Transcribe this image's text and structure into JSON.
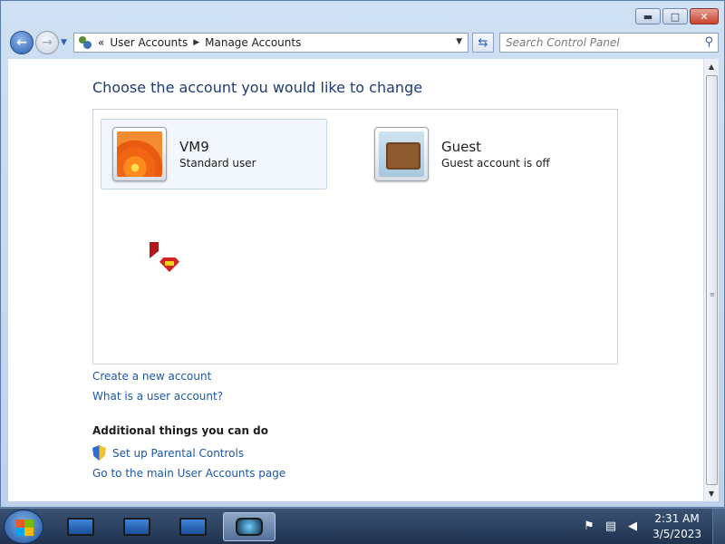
{
  "window": {
    "controls": {
      "minimize": "▬",
      "maximize": "□",
      "close": "✕"
    }
  },
  "nav": {
    "history_chevron": "«",
    "breadcrumbs": [
      "User Accounts",
      "Manage Accounts"
    ],
    "search_placeholder": "Search Control Panel"
  },
  "main": {
    "title": "Choose the account you would like to change",
    "accounts": [
      {
        "name": "VM9",
        "type": "Standard user",
        "picture": "flower",
        "selected": true
      },
      {
        "name": "Guest",
        "type": "Guest account is off",
        "picture": "suitcase",
        "selected": false
      }
    ],
    "links": {
      "create": "Create a new account",
      "what_is": "What is a user account?"
    },
    "additional": {
      "heading": "Additional things you can do",
      "parental": "Set up Parental Controls",
      "main_page": "Go to the main User Accounts page"
    }
  },
  "taskbar": {
    "items": [
      "monitor-icon",
      "monitor-icon",
      "monitor-icon",
      "app-icon"
    ],
    "clock": {
      "time": "2:31 AM",
      "date": "3/5/2023"
    },
    "tray": [
      "action-center-icon",
      "network-icon",
      "volume-muted-icon"
    ]
  },
  "colors": {
    "link": "#1c57a8",
    "title": "#1e3b73",
    "close": "#c6422e"
  }
}
